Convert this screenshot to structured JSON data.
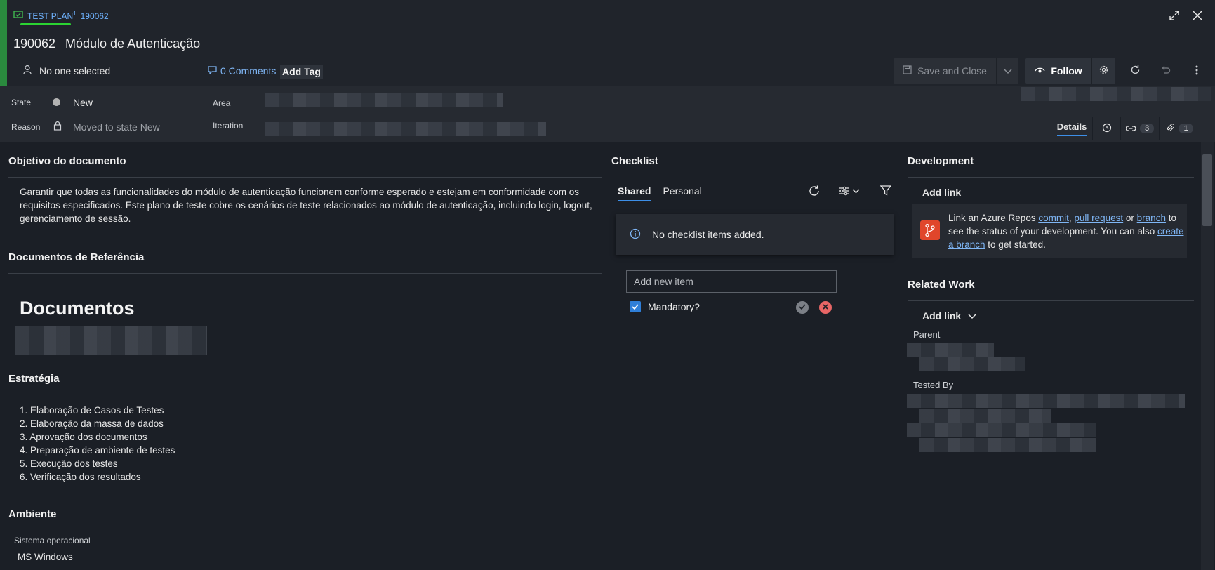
{
  "header": {
    "type_label": "TEST PLAN",
    "type_sup": "1",
    "id_link": "190062",
    "id": "190062",
    "title": "Módulo de Autenticação",
    "assigned": "No one selected",
    "comments": "0 Comments",
    "add_tag": "Add Tag",
    "save_close": "Save and Close",
    "follow": "Follow"
  },
  "fields": {
    "state_label": "State",
    "state_value": "New",
    "reason_label": "Reason",
    "reason_value": "Moved to state New",
    "area_label": "Area",
    "iteration_label": "Iteration"
  },
  "tabs": {
    "details": "Details",
    "links_count": "3",
    "attach_count": "1"
  },
  "left": {
    "objetivo_title": "Objetivo do documento",
    "objetivo_text": "Garantir que todas as funcionalidades do módulo de autenticação funcionem conforme esperado e estejam em conformidade com os requisitos especificados. Este plano de teste cobre os cenários de teste relacionados ao módulo de autenticação, incluindo login, logout, gerenciamento de sessão.",
    "docs_title": "Documentos de Referência",
    "docs_heading": "Documentos",
    "estrategia_title": "Estratégia",
    "estrategia_items": [
      "1. Elaboração de Casos de Testes",
      "2. Elaboração da massa de dados",
      "3. Aprovação dos documentos",
      "4. Preparação de ambiente de testes",
      "5. Execução dos testes",
      "6. Verificação dos resultados"
    ],
    "ambiente_title": "Ambiente",
    "so_label": "Sistema operacional",
    "so_value": "MS Windows"
  },
  "checklist": {
    "title": "Checklist",
    "tab_shared": "Shared",
    "tab_personal": "Personal",
    "empty_message": "No checklist items added.",
    "add_placeholder": "Add new item",
    "mandatory_label": "Mandatory?"
  },
  "development": {
    "title": "Development",
    "add_link": "Add link",
    "text_1": "Link an Azure Repos ",
    "link_commit": "commit",
    "sep_1": ", ",
    "link_pr": "pull request",
    "sep_2": " or ",
    "link_branch": "branch",
    "text_2": " to see the status of your development. You can also ",
    "link_create_branch": "create a branch",
    "text_3": " to get started."
  },
  "related": {
    "title": "Related Work",
    "add_link": "Add link",
    "parent_label": "Parent",
    "tested_by_label": "Tested By"
  },
  "colors": {
    "accent_green": "#2a8a3e",
    "link_blue": "#7fb6f5",
    "tab_underline": "#3d8fe8",
    "repo_orange": "#e0462b"
  }
}
